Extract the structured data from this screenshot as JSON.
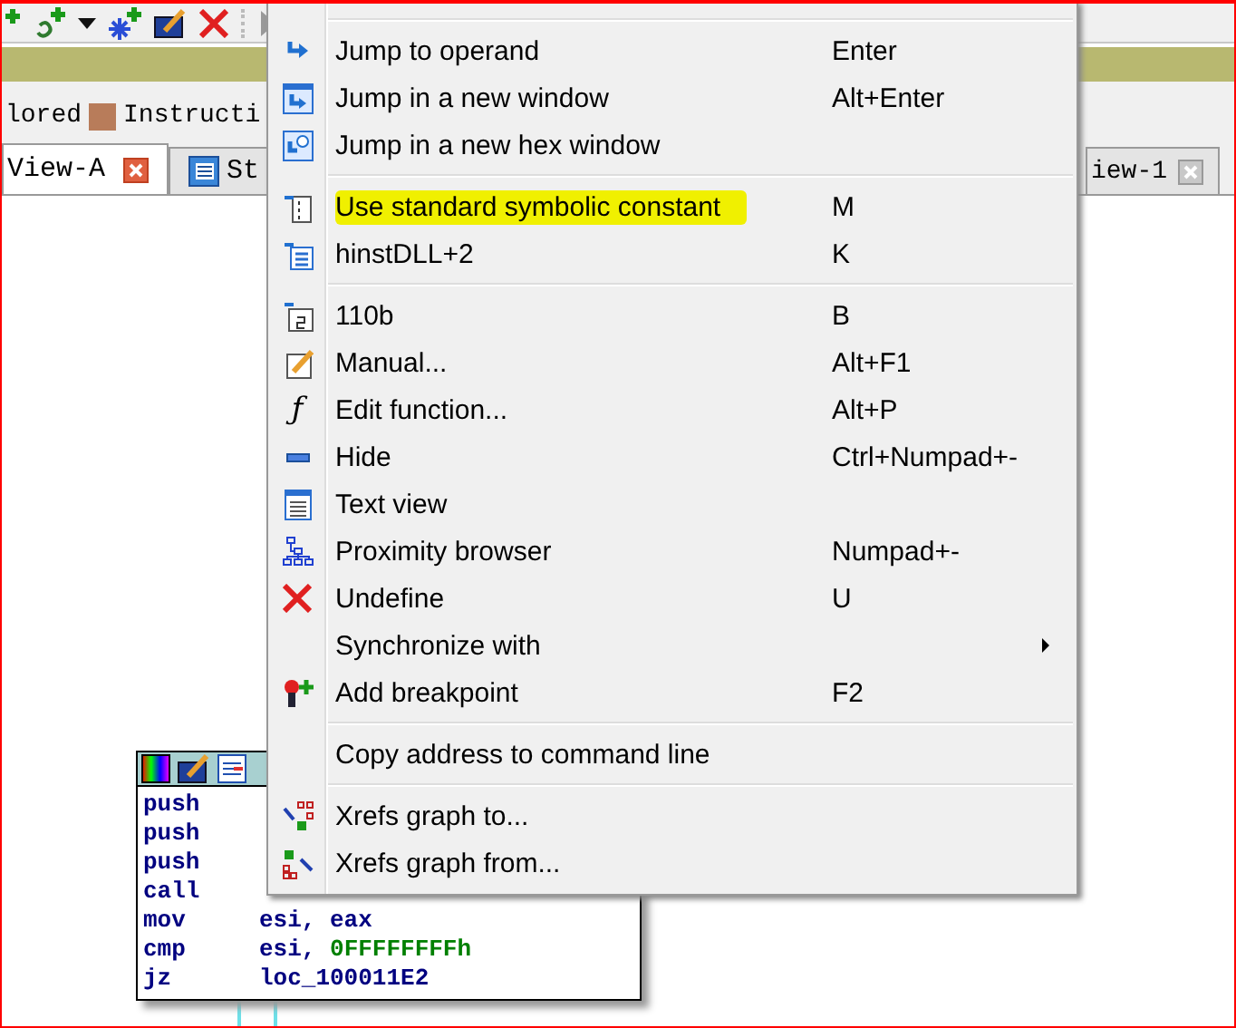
{
  "legend": [
    {
      "label": "lored"
    },
    {
      "label": "Instructi",
      "color": "#b87c5a"
    }
  ],
  "tabs": [
    {
      "label": "View-A",
      "selected": true
    },
    {
      "label": "St",
      "selected": false
    },
    {
      "label": "iew-1",
      "selected": false
    }
  ],
  "graph_node": {
    "lines": [
      {
        "mnemonic": "push"
      },
      {
        "mnemonic": "push"
      },
      {
        "mnemonic": "push"
      },
      {
        "mnemonic": "call"
      },
      {
        "mnemonic": "mov",
        "operand": "esi, eax"
      },
      {
        "mnemonic": "cmp",
        "operand": "esi, ",
        "constant": "0FFFFFFFFh"
      },
      {
        "mnemonic": "jz",
        "operand": "loc_100011E2"
      }
    ]
  },
  "context_menu": {
    "items": [
      {
        "kind": "separator"
      },
      {
        "kind": "item",
        "label": "Jump to operand",
        "shortcut": "Enter",
        "highlighted": false,
        "submenu": false
      },
      {
        "kind": "item",
        "label": "Jump in a new window",
        "shortcut": "Alt+Enter",
        "highlighted": false,
        "submenu": false
      },
      {
        "kind": "item",
        "label": "Jump in a new hex window",
        "highlighted": false,
        "submenu": false
      },
      {
        "kind": "separator"
      },
      {
        "kind": "item",
        "label": "Use standard symbolic constant",
        "shortcut": "M",
        "highlighted": true,
        "submenu": false
      },
      {
        "kind": "item",
        "label": "hinstDLL+2",
        "shortcut": "K",
        "highlighted": false,
        "submenu": false
      },
      {
        "kind": "separator"
      },
      {
        "kind": "item",
        "label": "110b",
        "shortcut": "B",
        "highlighted": false,
        "submenu": false
      },
      {
        "kind": "item",
        "label": "Manual...",
        "shortcut": "Alt+F1",
        "highlighted": false,
        "submenu": false
      },
      {
        "kind": "item",
        "glyph": "ƒ",
        "label": "Edit function...",
        "shortcut": "Alt+P",
        "highlighted": false,
        "submenu": false
      },
      {
        "kind": "item",
        "label": "Hide",
        "shortcut": "Ctrl+Numpad+-",
        "highlighted": false,
        "submenu": false
      },
      {
        "kind": "item",
        "label": "Text view",
        "highlighted": false,
        "submenu": false
      },
      {
        "kind": "item",
        "label": "Proximity browser",
        "shortcut": "Numpad+-",
        "highlighted": false,
        "submenu": false
      },
      {
        "kind": "item",
        "label": "Undefine",
        "shortcut": "U",
        "highlighted": false,
        "submenu": false
      },
      {
        "kind": "item",
        "label": "Synchronize with",
        "highlighted": false,
        "submenu": true
      },
      {
        "kind": "item",
        "label": "Add breakpoint",
        "shortcut": "F2",
        "highlighted": false,
        "submenu": false
      },
      {
        "kind": "separator"
      },
      {
        "kind": "item",
        "label": "Copy address to command line",
        "highlighted": false,
        "submenu": false
      },
      {
        "kind": "separator"
      },
      {
        "kind": "item",
        "label": "Xrefs graph to...",
        "highlighted": false,
        "submenu": false
      },
      {
        "kind": "item",
        "label": "Xrefs graph from...",
        "highlighted": false,
        "submenu": false
      }
    ]
  }
}
